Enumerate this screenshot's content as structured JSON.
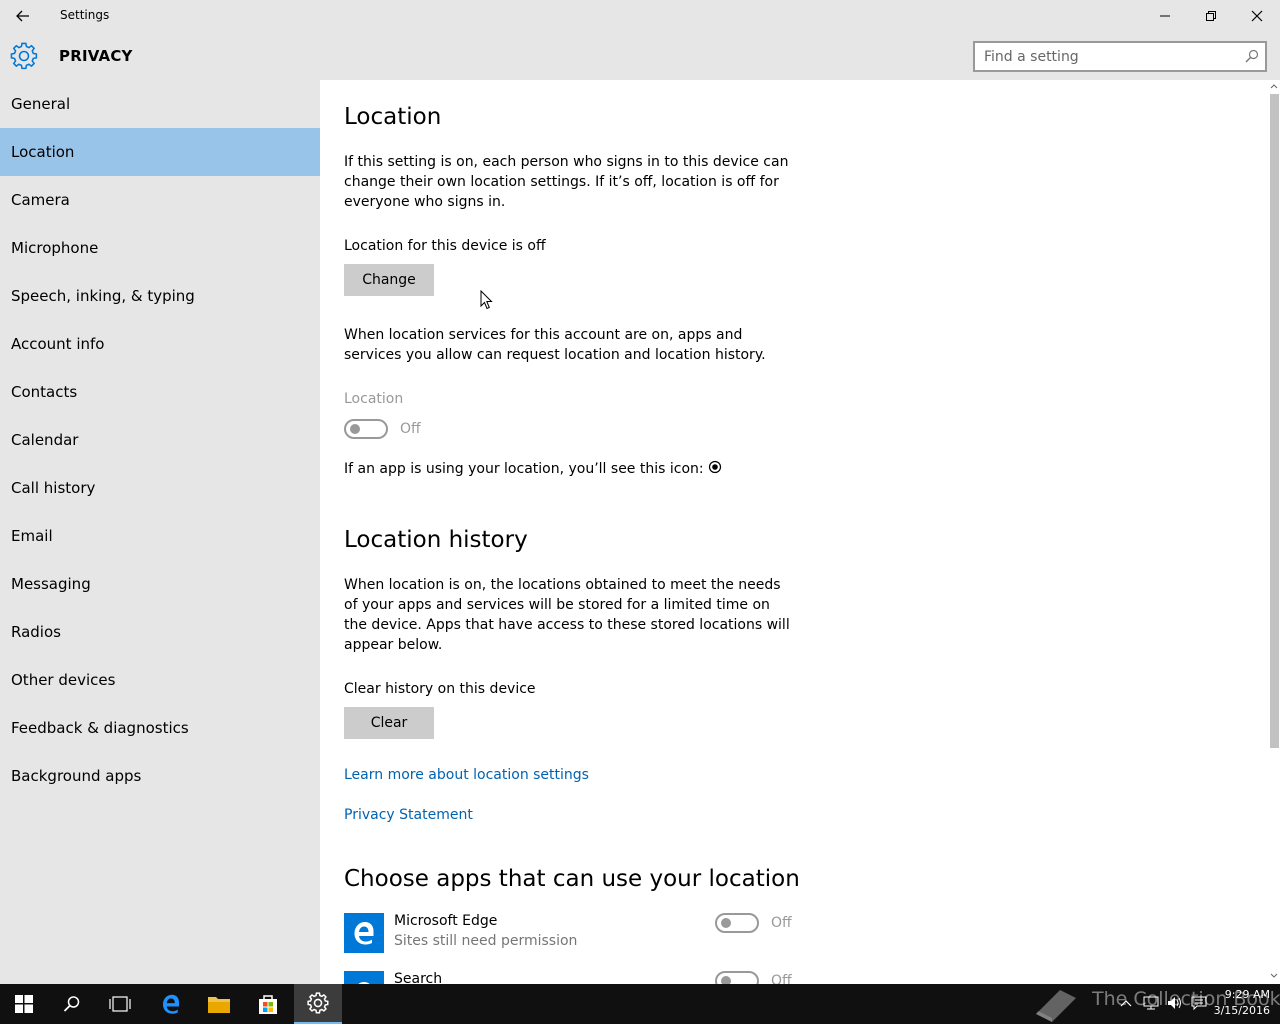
{
  "window": {
    "title": "Settings"
  },
  "header": {
    "section": "PRIVACY",
    "search_placeholder": "Find a setting"
  },
  "sidebar": {
    "items": [
      {
        "label": "General"
      },
      {
        "label": "Location"
      },
      {
        "label": "Camera"
      },
      {
        "label": "Microphone"
      },
      {
        "label": "Speech, inking, & typing"
      },
      {
        "label": "Account info"
      },
      {
        "label": "Contacts"
      },
      {
        "label": "Calendar"
      },
      {
        "label": "Call history"
      },
      {
        "label": "Email"
      },
      {
        "label": "Messaging"
      },
      {
        "label": "Radios"
      },
      {
        "label": "Other devices"
      },
      {
        "label": "Feedback & diagnostics"
      },
      {
        "label": "Background apps"
      }
    ],
    "active_index": 1,
    "active_color": "#99c4ea"
  },
  "main": {
    "location": {
      "heading": "Location",
      "intro": "If this setting is on, each person who signs in to this device can change their own location settings. If it’s off, location is off for everyone who signs in.",
      "device_status": "Location for this device is off",
      "change_button": "Change",
      "account_text": "When location services for this account are on, apps and services you allow can request location and location history.",
      "toggle_label": "Location",
      "toggle_state": "Off",
      "icon_text": "If an app is using your location, you’ll see this icon:"
    },
    "history": {
      "heading": "Location history",
      "text": "When location is on, the locations obtained to meet the needs of your apps and services will be stored for a limited time on the device. Apps that have access to these stored locations will appear below.",
      "clear_label": "Clear history on this device",
      "clear_button": "Clear"
    },
    "links": {
      "learn_more": "Learn more about location settings",
      "privacy": "Privacy Statement"
    },
    "apps": {
      "heading": "Choose apps that can use your location",
      "items": [
        {
          "name": "Microsoft Edge",
          "sub": "Sites still need permission",
          "state": "Off"
        },
        {
          "name": "Search",
          "sub": "",
          "state": "Off"
        }
      ]
    }
  },
  "taskbar": {
    "time": "9:29 AM",
    "date": "3/15/2016",
    "watermark": "The Collection Book"
  },
  "colors": {
    "accent": "#0078d7",
    "link": "#0063b1"
  }
}
